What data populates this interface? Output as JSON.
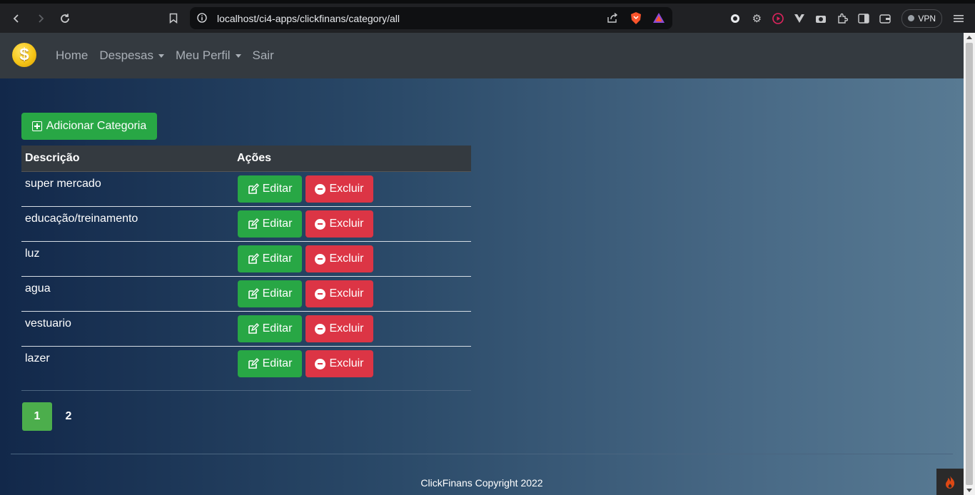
{
  "browser": {
    "url": "localhost/ci4-apps/clickfinans/category/all",
    "vpn_label": "VPN"
  },
  "navbar": {
    "logo_symbol": "$",
    "items": [
      {
        "label": "Home",
        "dropdown": false
      },
      {
        "label": "Despesas",
        "dropdown": true
      },
      {
        "label": "Meu Perfil",
        "dropdown": true
      },
      {
        "label": "Sair",
        "dropdown": false
      }
    ]
  },
  "add_button": "Adicionar Categoria",
  "table": {
    "headers": [
      "Descrição",
      "Ações"
    ],
    "edit_label": "Editar",
    "delete_label": "Excluir",
    "rows": [
      {
        "descricao": "super mercado"
      },
      {
        "descricao": "educação/treinamento"
      },
      {
        "descricao": "luz"
      },
      {
        "descricao": "agua"
      },
      {
        "descricao": "vestuario"
      },
      {
        "descricao": "lazer"
      }
    ]
  },
  "pagination": {
    "pages": [
      "1",
      "2"
    ],
    "active": "1"
  },
  "footer": "ClickFinans Copyright 2022",
  "colors": {
    "success": "#28a745",
    "danger": "#dc3545",
    "navbar": "#343a40"
  }
}
